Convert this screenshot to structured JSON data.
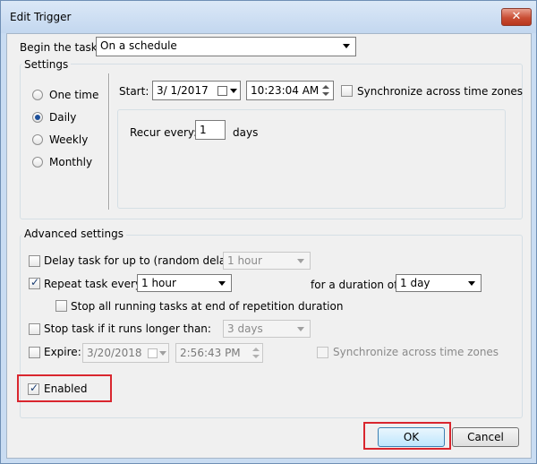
{
  "window": {
    "title": "Edit Trigger",
    "close_glyph": "✕"
  },
  "begin_task": {
    "label": "Begin the task:",
    "value": "On a schedule"
  },
  "settings": {
    "title": "Settings",
    "radios": [
      {
        "label": "One time",
        "selected": false
      },
      {
        "label": "Daily",
        "selected": true
      },
      {
        "label": "Weekly",
        "selected": false
      },
      {
        "label": "Monthly",
        "selected": false
      }
    ],
    "start_label": "Start:",
    "start_date": "3/ 1/2017",
    "start_time": "10:23:04 AM",
    "sync_label": "Synchronize across time zones",
    "recur_label": "Recur every:",
    "recur_value": "1",
    "recur_unit": "days"
  },
  "advanced": {
    "title": "Advanced settings",
    "delay_label": "Delay task for up to (random delay):",
    "delay_value": "1 hour",
    "repeat_label": "Repeat task every:",
    "repeat_value": "1 hour",
    "duration_label": "for a duration of:",
    "duration_value": "1 day",
    "stop_all_label": "Stop all running tasks at end of repetition duration",
    "stop_long_label": "Stop task if it runs longer than:",
    "stop_long_value": "3 days",
    "expire_label": "Expire:",
    "expire_date": "3/20/2018",
    "expire_time": "2:56:43 PM",
    "expire_sync_label": "Synchronize across time zones",
    "enabled_label": "Enabled"
  },
  "buttons": {
    "ok": "OK",
    "cancel": "Cancel"
  },
  "colors": {
    "highlight": "#d9262e",
    "frame": "#c9dcf2",
    "dialog_bg": "#f0f0f0"
  }
}
